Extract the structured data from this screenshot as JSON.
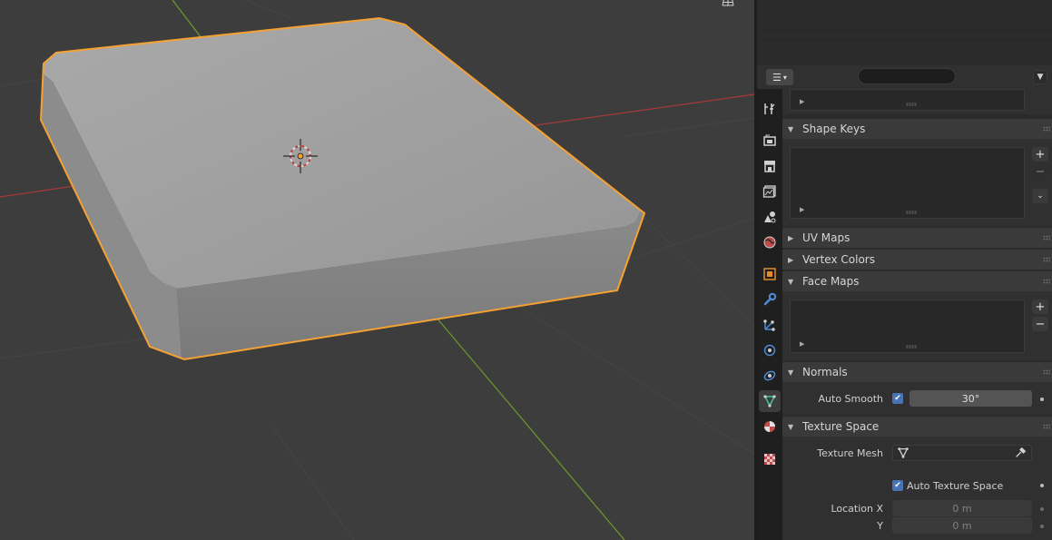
{
  "viewport": {
    "grid_toggle_icon": "grid-icon"
  },
  "properties": {
    "search": {
      "value": "",
      "placeholder": "",
      "icon": "search-icon"
    },
    "editor_type_icon": "editor-type-icon",
    "options_icon": "chevron-down-icon",
    "tabs": [
      {
        "name": "tool",
        "icon": "tool-icon",
        "active": false
      },
      {
        "name": "render",
        "icon": "render-icon",
        "active": false
      },
      {
        "name": "output",
        "icon": "output-icon",
        "active": false
      },
      {
        "name": "view-layer",
        "icon": "view-layer-icon",
        "active": false
      },
      {
        "name": "scene",
        "icon": "scene-icon",
        "active": false
      },
      {
        "name": "world",
        "icon": "world-icon",
        "active": false
      },
      {
        "name": "object",
        "icon": "object-icon",
        "active": false
      },
      {
        "name": "modifiers",
        "icon": "wrench-icon",
        "active": false
      },
      {
        "name": "particles",
        "icon": "particles-icon",
        "active": false
      },
      {
        "name": "physics",
        "icon": "physics-icon",
        "active": false
      },
      {
        "name": "constraints",
        "icon": "constraints-icon",
        "active": false
      },
      {
        "name": "data",
        "icon": "mesh-data-icon",
        "active": true
      },
      {
        "name": "material",
        "icon": "material-icon",
        "active": false
      },
      {
        "name": "texture",
        "icon": "texture-icon",
        "active": false
      }
    ],
    "panels": {
      "shape_keys": {
        "label": "Shape Keys",
        "expanded": true,
        "add": "+",
        "remove": "−"
      },
      "uv_maps": {
        "label": "UV Maps",
        "expanded": false
      },
      "vertex_colors": {
        "label": "Vertex Colors",
        "expanded": false
      },
      "face_maps": {
        "label": "Face Maps",
        "expanded": true,
        "add": "+",
        "remove": "−"
      },
      "normals": {
        "label": "Normals",
        "expanded": true,
        "auto_smooth_label": "Auto Smooth",
        "auto_smooth_checked": true,
        "angle": "30°"
      },
      "texture_space": {
        "label": "Texture Space",
        "expanded": true,
        "texture_mesh_label": "Texture Mesh",
        "texture_mesh_value": "",
        "auto_texture_space_label": "Auto Texture Space",
        "auto_texture_space_checked": true,
        "location_x_label": "Location X",
        "location_x": "0 m",
        "location_y_label": "Y",
        "location_y": "0 m"
      }
    }
  },
  "colors": {
    "selection_outline": "#f5a133",
    "x_axis": "#a8393b",
    "y_axis": "#6e9a2c",
    "checkbox": "#4772b3"
  }
}
